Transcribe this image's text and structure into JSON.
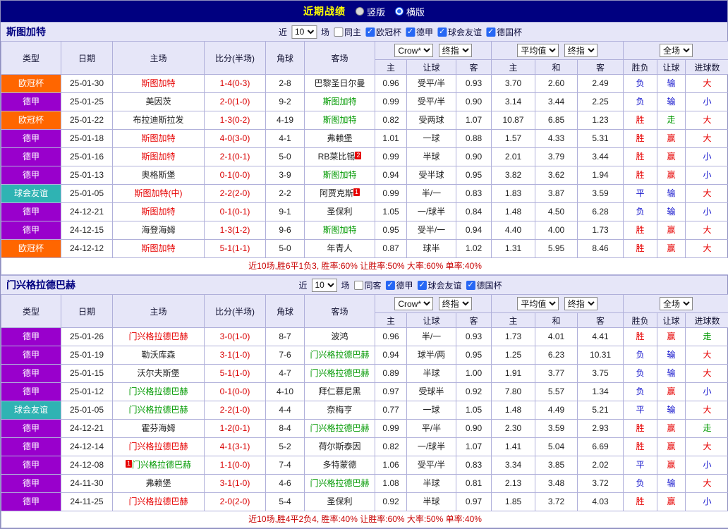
{
  "titlebar": {
    "title": "近期战绩",
    "radios": [
      {
        "label": "竖版",
        "checked": false
      },
      {
        "label": "横版",
        "checked": true
      }
    ]
  },
  "table_header": {
    "type": "类型",
    "date": "日期",
    "home": "主场",
    "score": "比分(半场)",
    "corner": "角球",
    "away": "客场",
    "bookmaker": "Crow*",
    "stage": "终指",
    "average": "平均值",
    "stage2": "终指",
    "scope": "全场",
    "sub": [
      "主",
      "让球",
      "客",
      "主",
      "和",
      "客",
      "胜负",
      "让球",
      "进球数"
    ]
  },
  "colors": {
    "titlebar_bg": "#000080",
    "title_text": "#ffff00",
    "header_bg": "#e6e6f8",
    "border": "#b0b0da",
    "champions_league": "#ff6600",
    "bundesliga": "#9900cc",
    "friendly": "#2fb3b3",
    "team_home_red": "#e60000",
    "team_away_green": "#009900",
    "score_red": "#d90000",
    "result_red": "#e60000",
    "result_blue": "#1414cc",
    "result_green": "#009900",
    "summary_red": "#c80000",
    "checkbox_accent": "#2767f4"
  },
  "sections": [
    {
      "team": "斯图加特",
      "filter": {
        "near": "近",
        "count": "10",
        "unit": "场",
        "same_venue": {
          "label": "同主",
          "checked": false
        },
        "leagues": [
          {
            "label": "欧冠杯",
            "checked": true
          },
          {
            "label": "德甲",
            "checked": true
          },
          {
            "label": "球会友谊",
            "checked": true
          },
          {
            "label": "德国杯",
            "checked": true
          }
        ]
      },
      "rows": [
        {
          "t": "欧冠杯",
          "tc": "lg-ucl",
          "d": "25-01-30",
          "h": "斯图加特",
          "hc": "c-r",
          "hb": "",
          "s": "1-4(0-3)",
          "cn": "2-8",
          "a": "巴黎圣日尔曼",
          "ac": "c-k",
          "ab": "",
          "w1": "0.96",
          "hd": "受平/半",
          "w2": "0.93",
          "m1": "3.70",
          "m2": "2.60",
          "m3": "2.49",
          "r1": "负",
          "r1c": "c-b",
          "r2": "输",
          "r2c": "c-b",
          "r3": "大",
          "r3c": "c-r"
        },
        {
          "t": "德甲",
          "tc": "lg-de",
          "d": "25-01-25",
          "h": "美因茨",
          "hc": "c-k",
          "hb": "",
          "s": "2-0(1-0)",
          "cn": "9-2",
          "a": "斯图加特",
          "ac": "c-g",
          "ab": "",
          "w1": "0.99",
          "hd": "受平/半",
          "w2": "0.90",
          "m1": "3.14",
          "m2": "3.44",
          "m3": "2.25",
          "r1": "负",
          "r1c": "c-b",
          "r2": "输",
          "r2c": "c-b",
          "r3": "小",
          "r3c": "c-b"
        },
        {
          "t": "欧冠杯",
          "tc": "lg-ucl",
          "d": "25-01-22",
          "h": "布拉迪斯拉发",
          "hc": "c-k",
          "hb": "",
          "s": "1-3(0-2)",
          "cn": "4-19",
          "a": "斯图加特",
          "ac": "c-g",
          "ab": "",
          "w1": "0.82",
          "hd": "受两球",
          "w2": "1.07",
          "m1": "10.87",
          "m2": "6.85",
          "m3": "1.23",
          "r1": "胜",
          "r1c": "c-r",
          "r2": "走",
          "r2c": "c-g",
          "r3": "大",
          "r3c": "c-r"
        },
        {
          "t": "德甲",
          "tc": "lg-de",
          "d": "25-01-18",
          "h": "斯图加特",
          "hc": "c-r",
          "hb": "",
          "s": "4-0(3-0)",
          "cn": "4-1",
          "a": "弗赖堡",
          "ac": "c-k",
          "ab": "",
          "w1": "1.01",
          "hd": "一球",
          "w2": "0.88",
          "m1": "1.57",
          "m2": "4.33",
          "m3": "5.31",
          "r1": "胜",
          "r1c": "c-r",
          "r2": "赢",
          "r2c": "c-r",
          "r3": "大",
          "r3c": "c-r"
        },
        {
          "t": "德甲",
          "tc": "lg-de",
          "d": "25-01-16",
          "h": "斯图加特",
          "hc": "c-r",
          "hb": "",
          "s": "2-1(0-1)",
          "cn": "5-0",
          "a": "RB莱比锡",
          "ac": "c-k",
          "ab": "2",
          "w1": "0.99",
          "hd": "半球",
          "w2": "0.90",
          "m1": "2.01",
          "m2": "3.79",
          "m3": "3.44",
          "r1": "胜",
          "r1c": "c-r",
          "r2": "赢",
          "r2c": "c-r",
          "r3": "小",
          "r3c": "c-b"
        },
        {
          "t": "德甲",
          "tc": "lg-de",
          "d": "25-01-13",
          "h": "奥格斯堡",
          "hc": "c-k",
          "hb": "",
          "s": "0-1(0-0)",
          "cn": "3-9",
          "a": "斯图加特",
          "ac": "c-g",
          "ab": "",
          "w1": "0.94",
          "hd": "受半球",
          "w2": "0.95",
          "m1": "3.82",
          "m2": "3.62",
          "m3": "1.94",
          "r1": "胜",
          "r1c": "c-r",
          "r2": "赢",
          "r2c": "c-r",
          "r3": "小",
          "r3c": "c-b"
        },
        {
          "t": "球会友谊",
          "tc": "lg-fr",
          "d": "25-01-05",
          "h": "斯图加特(中)",
          "hc": "c-r",
          "hb": "",
          "s": "2-2(2-0)",
          "cn": "2-2",
          "a": "阿贾克斯",
          "ac": "c-k",
          "ab": "1",
          "w1": "0.99",
          "hd": "半/一",
          "w2": "0.83",
          "m1": "1.83",
          "m2": "3.87",
          "m3": "3.59",
          "r1": "平",
          "r1c": "c-b",
          "r2": "输",
          "r2c": "c-b",
          "r3": "大",
          "r3c": "c-r"
        },
        {
          "t": "德甲",
          "tc": "lg-de",
          "d": "24-12-21",
          "h": "斯图加特",
          "hc": "c-r",
          "hb": "",
          "s": "0-1(0-1)",
          "cn": "9-1",
          "a": "圣保利",
          "ac": "c-k",
          "ab": "",
          "w1": "1.05",
          "hd": "一/球半",
          "w2": "0.84",
          "m1": "1.48",
          "m2": "4.50",
          "m3": "6.28",
          "r1": "负",
          "r1c": "c-b",
          "r2": "输",
          "r2c": "c-b",
          "r3": "小",
          "r3c": "c-b"
        },
        {
          "t": "德甲",
          "tc": "lg-de",
          "d": "24-12-15",
          "h": "海登海姆",
          "hc": "c-k",
          "hb": "",
          "s": "1-3(1-2)",
          "cn": "9-6",
          "a": "斯图加特",
          "ac": "c-g",
          "ab": "",
          "w1": "0.95",
          "hd": "受半/一",
          "w2": "0.94",
          "m1": "4.40",
          "m2": "4.00",
          "m3": "1.73",
          "r1": "胜",
          "r1c": "c-r",
          "r2": "赢",
          "r2c": "c-r",
          "r3": "大",
          "r3c": "c-r"
        },
        {
          "t": "欧冠杯",
          "tc": "lg-ucl",
          "d": "24-12-12",
          "h": "斯图加特",
          "hc": "c-r",
          "hb": "",
          "s": "5-1(1-1)",
          "cn": "5-0",
          "a": "年青人",
          "ac": "c-k",
          "ab": "",
          "w1": "0.87",
          "hd": "球半",
          "w2": "1.02",
          "m1": "1.31",
          "m2": "5.95",
          "m3": "8.46",
          "r1": "胜",
          "r1c": "c-r",
          "r2": "赢",
          "r2c": "c-r",
          "r3": "大",
          "r3c": "c-r"
        }
      ],
      "summary": "近10场,胜6平1负3, 胜率:60% 让胜率:50% 大率:60% 单率:40%"
    },
    {
      "team": "门兴格拉德巴赫",
      "filter": {
        "near": "近",
        "count": "10",
        "unit": "场",
        "same_venue": {
          "label": "同客",
          "checked": false
        },
        "leagues": [
          {
            "label": "德甲",
            "checked": true
          },
          {
            "label": "球会友谊",
            "checked": true
          },
          {
            "label": "德国杯",
            "checked": true
          }
        ]
      },
      "rows": [
        {
          "t": "德甲",
          "tc": "lg-de",
          "d": "25-01-26",
          "h": "门兴格拉德巴赫",
          "hc": "c-r",
          "hb": "",
          "s": "3-0(1-0)",
          "cn": "8-7",
          "a": "波鸿",
          "ac": "c-k",
          "ab": "",
          "w1": "0.96",
          "hd": "半/一",
          "w2": "0.93",
          "m1": "1.73",
          "m2": "4.01",
          "m3": "4.41",
          "r1": "胜",
          "r1c": "c-r",
          "r2": "赢",
          "r2c": "c-r",
          "r3": "走",
          "r3c": "c-g"
        },
        {
          "t": "德甲",
          "tc": "lg-de",
          "d": "25-01-19",
          "h": "勒沃库森",
          "hc": "c-k",
          "hb": "",
          "s": "3-1(1-0)",
          "cn": "7-6",
          "a": "门兴格拉德巴赫",
          "ac": "c-g",
          "ab": "",
          "w1": "0.94",
          "hd": "球半/两",
          "w2": "0.95",
          "m1": "1.25",
          "m2": "6.23",
          "m3": "10.31",
          "r1": "负",
          "r1c": "c-b",
          "r2": "输",
          "r2c": "c-b",
          "r3": "大",
          "r3c": "c-r"
        },
        {
          "t": "德甲",
          "tc": "lg-de",
          "d": "25-01-15",
          "h": "沃尔夫斯堡",
          "hc": "c-k",
          "hb": "",
          "s": "5-1(1-0)",
          "cn": "4-7",
          "a": "门兴格拉德巴赫",
          "ac": "c-g",
          "ab": "",
          "w1": "0.89",
          "hd": "半球",
          "w2": "1.00",
          "m1": "1.91",
          "m2": "3.77",
          "m3": "3.75",
          "r1": "负",
          "r1c": "c-b",
          "r2": "输",
          "r2c": "c-b",
          "r3": "大",
          "r3c": "c-r"
        },
        {
          "t": "德甲",
          "tc": "lg-de",
          "d": "25-01-12",
          "h": "门兴格拉德巴赫",
          "hc": "c-g",
          "hb": "",
          "s": "0-1(0-0)",
          "cn": "4-10",
          "a": "拜仁慕尼黑",
          "ac": "c-k",
          "ab": "",
          "w1": "0.97",
          "hd": "受球半",
          "w2": "0.92",
          "m1": "7.80",
          "m2": "5.57",
          "m3": "1.34",
          "r1": "负",
          "r1c": "c-b",
          "r2": "赢",
          "r2c": "c-r",
          "r3": "小",
          "r3c": "c-b"
        },
        {
          "t": "球会友谊",
          "tc": "lg-fr",
          "d": "25-01-05",
          "h": "门兴格拉德巴赫",
          "hc": "c-g",
          "hb": "",
          "s": "2-2(1-0)",
          "cn": "4-4",
          "a": "奈梅亨",
          "ac": "c-k",
          "ab": "",
          "w1": "0.77",
          "hd": "一球",
          "w2": "1.05",
          "m1": "1.48",
          "m2": "4.49",
          "m3": "5.21",
          "r1": "平",
          "r1c": "c-b",
          "r2": "输",
          "r2c": "c-b",
          "r3": "大",
          "r3c": "c-r"
        },
        {
          "t": "德甲",
          "tc": "lg-de",
          "d": "24-12-21",
          "h": "霍芬海姆",
          "hc": "c-k",
          "hb": "",
          "s": "1-2(0-1)",
          "cn": "8-4",
          "a": "门兴格拉德巴赫",
          "ac": "c-g",
          "ab": "",
          "w1": "0.99",
          "hd": "平/半",
          "w2": "0.90",
          "m1": "2.30",
          "m2": "3.59",
          "m3": "2.93",
          "r1": "胜",
          "r1c": "c-r",
          "r2": "赢",
          "r2c": "c-r",
          "r3": "走",
          "r3c": "c-g"
        },
        {
          "t": "德甲",
          "tc": "lg-de",
          "d": "24-12-14",
          "h": "门兴格拉德巴赫",
          "hc": "c-r",
          "hb": "",
          "s": "4-1(3-1)",
          "cn": "5-2",
          "a": "荷尔斯泰因",
          "ac": "c-k",
          "ab": "",
          "w1": "0.82",
          "hd": "一/球半",
          "w2": "1.07",
          "m1": "1.41",
          "m2": "5.04",
          "m3": "6.69",
          "r1": "胜",
          "r1c": "c-r",
          "r2": "赢",
          "r2c": "c-r",
          "r3": "大",
          "r3c": "c-r"
        },
        {
          "t": "德甲",
          "tc": "lg-de",
          "d": "24-12-08",
          "h": "门兴格拉德巴赫",
          "hc": "c-g",
          "hb": "1",
          "s": "1-1(0-0)",
          "cn": "7-4",
          "a": "多特蒙德",
          "ac": "c-k",
          "ab": "",
          "w1": "1.06",
          "hd": "受平/半",
          "w2": "0.83",
          "m1": "3.34",
          "m2": "3.85",
          "m3": "2.02",
          "r1": "平",
          "r1c": "c-b",
          "r2": "赢",
          "r2c": "c-r",
          "r3": "小",
          "r3c": "c-b"
        },
        {
          "t": "德甲",
          "tc": "lg-de",
          "d": "24-11-30",
          "h": "弗赖堡",
          "hc": "c-k",
          "hb": "",
          "s": "3-1(1-0)",
          "cn": "4-6",
          "a": "门兴格拉德巴赫",
          "ac": "c-g",
          "ab": "",
          "w1": "1.08",
          "hd": "半球",
          "w2": "0.81",
          "m1": "2.13",
          "m2": "3.48",
          "m3": "3.72",
          "r1": "负",
          "r1c": "c-b",
          "r2": "输",
          "r2c": "c-b",
          "r3": "大",
          "r3c": "c-r"
        },
        {
          "t": "德甲",
          "tc": "lg-de",
          "d": "24-11-25",
          "h": "门兴格拉德巴赫",
          "hc": "c-r",
          "hb": "",
          "s": "2-0(2-0)",
          "cn": "5-4",
          "a": "圣保利",
          "ac": "c-k",
          "ab": "",
          "w1": "0.92",
          "hd": "半球",
          "w2": "0.97",
          "m1": "1.85",
          "m2": "3.72",
          "m3": "4.03",
          "r1": "胜",
          "r1c": "c-r",
          "r2": "赢",
          "r2c": "c-r",
          "r3": "小",
          "r3c": "c-b"
        }
      ],
      "summary": "近10场,胜4平2负4, 胜率:40% 让胜率:60% 大率:50% 单率:40%"
    }
  ]
}
